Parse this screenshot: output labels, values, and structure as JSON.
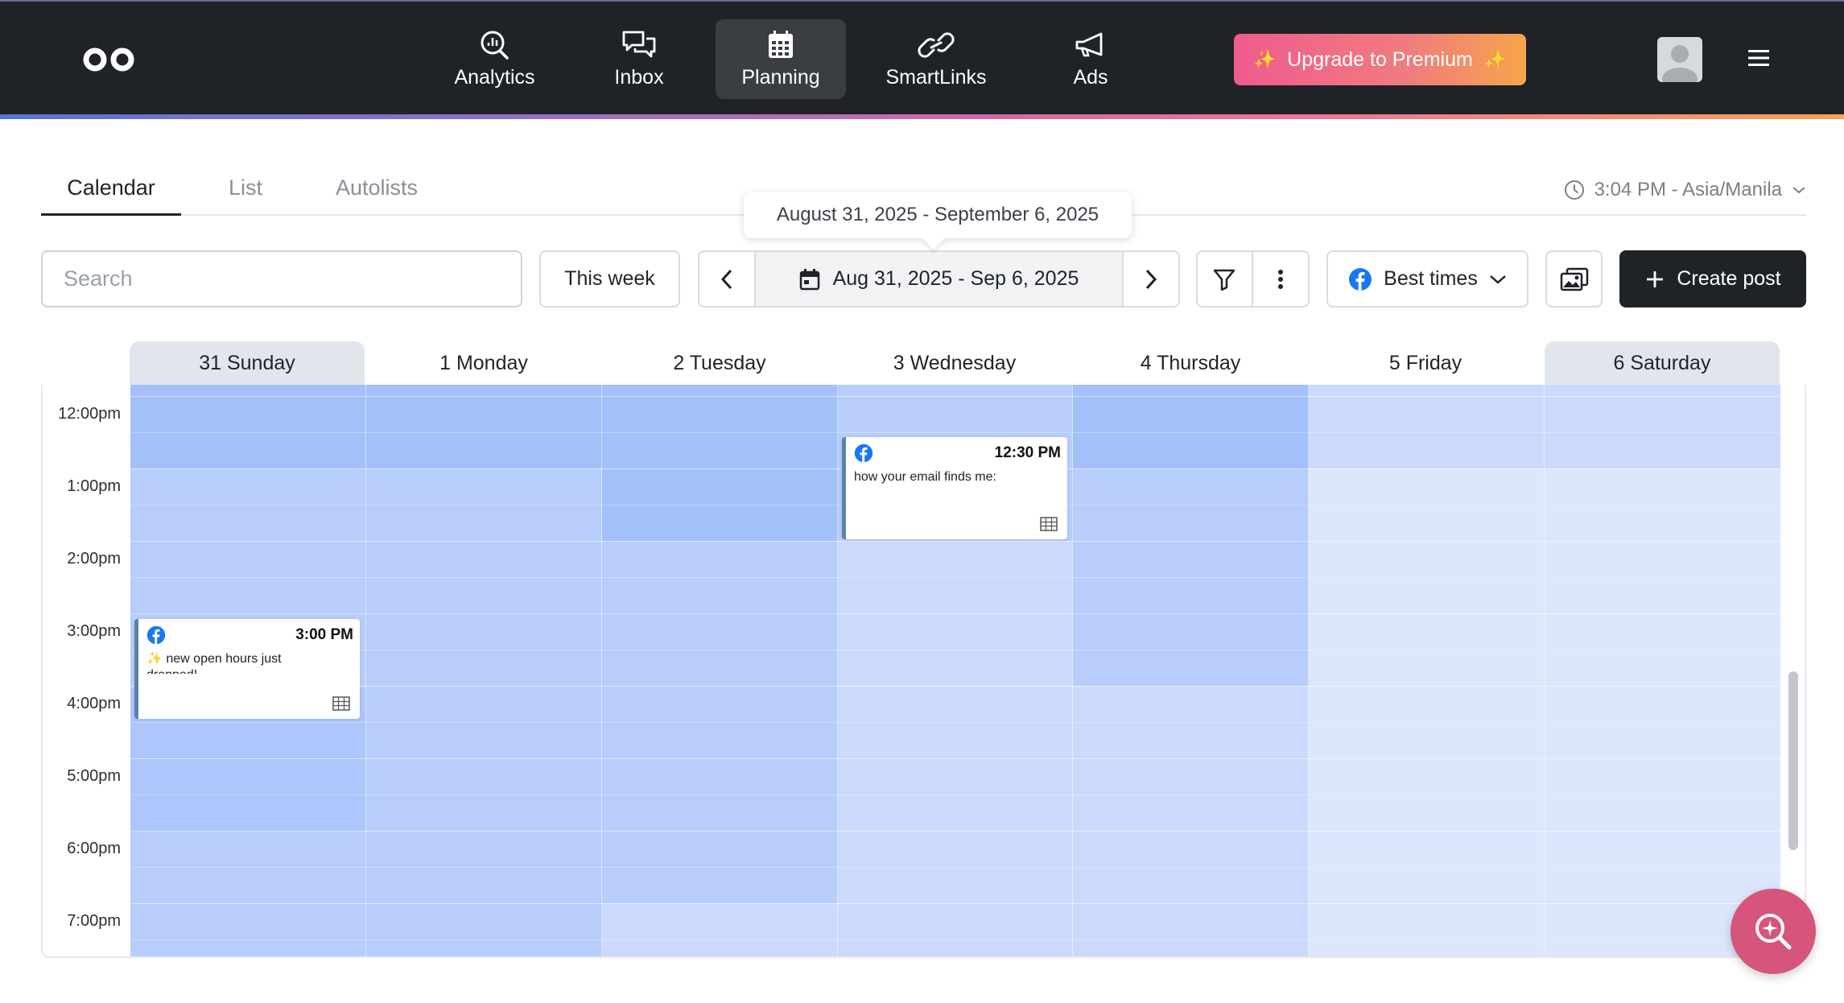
{
  "nav": {
    "items": [
      {
        "label": "Analytics",
        "icon": "analytics-search-icon"
      },
      {
        "label": "Inbox",
        "icon": "chat-bubbles-icon"
      },
      {
        "label": "Planning",
        "icon": "calendar-icon",
        "active": true
      },
      {
        "label": "SmartLinks",
        "icon": "link-icon"
      },
      {
        "label": "Ads",
        "icon": "megaphone-icon"
      }
    ],
    "upgrade_label": "Upgrade to Premium"
  },
  "tabs": [
    "Calendar",
    "List",
    "Autolists"
  ],
  "timezone": "3:04 PM - Asia/Manila",
  "tooltip": "August 31, 2025 - September 6, 2025",
  "toolbar": {
    "search_placeholder": "Search",
    "this_week": "This week",
    "date_range": "Aug 31, 2025 - Sep 6, 2025",
    "best_times": "Best times",
    "create_post": "Create post"
  },
  "calendar": {
    "days": [
      "31 Sunday",
      "1 Monday",
      "2 Tuesday",
      "3 Wednesday",
      "4 Thursday",
      "5 Friday",
      "6 Saturday"
    ],
    "times": [
      "12:00pm",
      "1:00pm",
      "2:00pm",
      "3:00pm",
      "4:00pm",
      "5:00pm",
      "6:00pm",
      "7:00pm"
    ],
    "posts": [
      {
        "day": "3 Wednesday",
        "time": "12:30 PM",
        "caption": "how your email finds me:",
        "network": "facebook"
      },
      {
        "day": "31 Sunday",
        "time": "3:00 PM",
        "caption": "✨ new open hours just dropped!",
        "network": "facebook"
      }
    ]
  },
  "colors": {
    "topbar": "#1f2226",
    "best_time_strong": "#a4c0fb",
    "best_time_medium": "#b7cdfb",
    "best_time_light": "#cbdafc",
    "best_time_faint": "#dce6fd",
    "facebook": "#1877f2",
    "fab": "#d6557a"
  }
}
